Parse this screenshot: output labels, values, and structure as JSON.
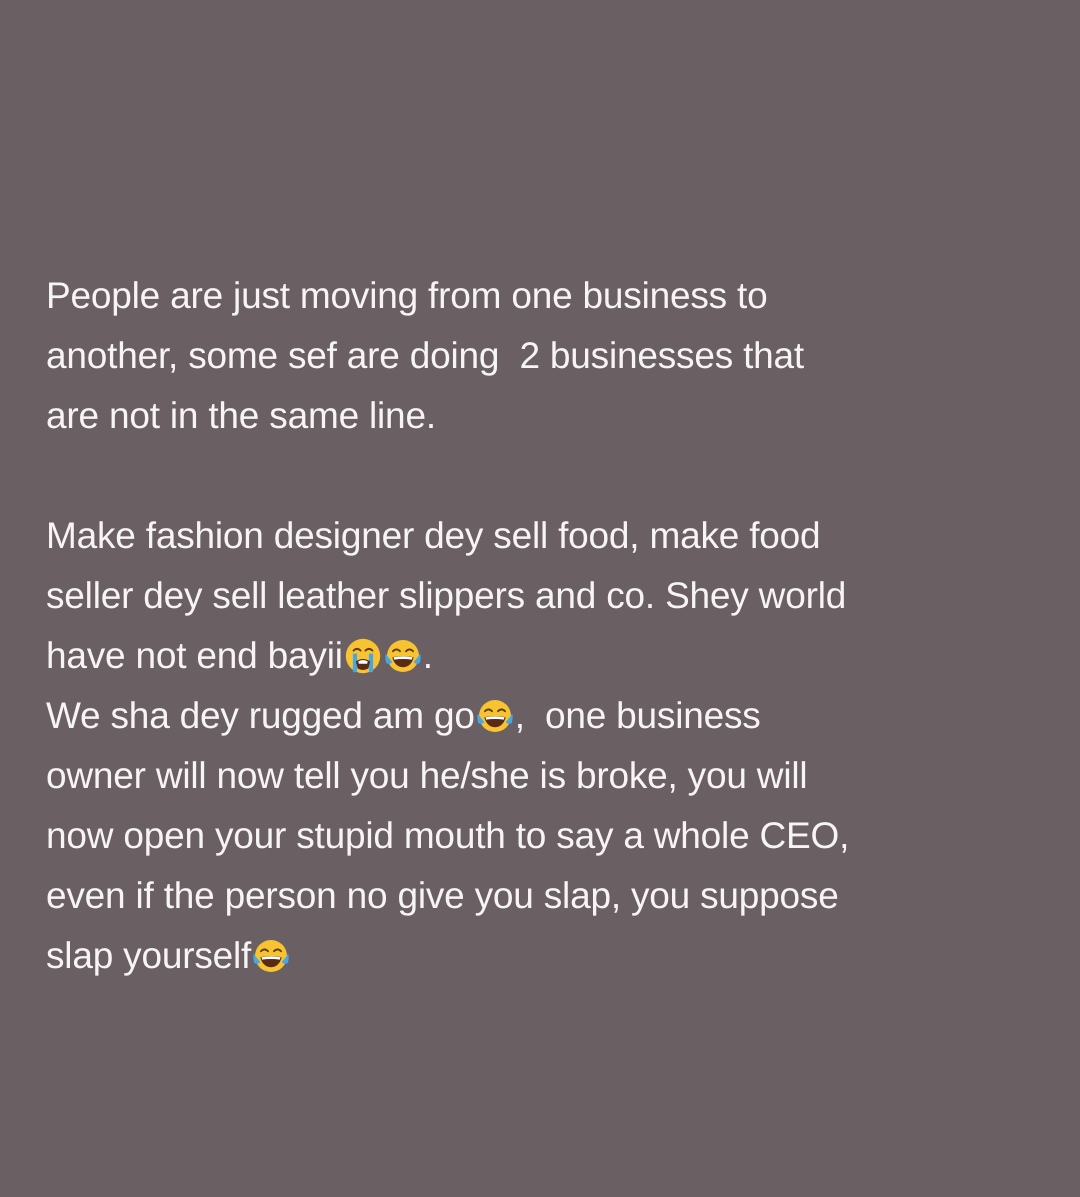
{
  "post": {
    "background_color": "#6a5f63",
    "text_color": "#f7f4f5",
    "paragraph_1": {
      "line_1": "People are just moving from one business to",
      "line_2": "another, some sef are doing  2 businesses that",
      "line_3": "are not in the same line."
    },
    "paragraph_2": {
      "line_1": "Make fashion designer dey sell food, make food",
      "line_2": "seller dey sell leather slippers and co. Shey world",
      "line_3_text": "have not end bayii",
      "line_3_emojis": [
        "loudly-crying-face-icon",
        "face-with-tears-of-joy-icon"
      ],
      "line_3_end": ".",
      "line_4_text": "We sha dey rugged am go",
      "line_4_emoji": "face-with-tears-of-joy-icon",
      "line_4_end": ",  one business",
      "line_5": "owner will now tell you he/she is broke, you will",
      "line_6": "now open your stupid mouth to say a whole CEO,",
      "line_7": "even if the person no give you slap, you suppose",
      "line_8_text": "slap yourself",
      "line_8_emoji": "face-with-tears-of-joy-icon"
    }
  }
}
